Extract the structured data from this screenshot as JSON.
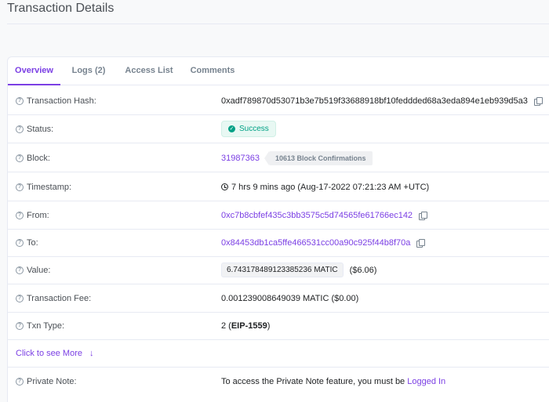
{
  "page": {
    "title": "Transaction Details"
  },
  "tabs": [
    {
      "label": "Overview",
      "active": true
    },
    {
      "label": "Logs (2)"
    },
    {
      "label": "Access List"
    },
    {
      "label": "Comments"
    }
  ],
  "rows": {
    "hash": {
      "label": "Transaction Hash:",
      "value": "0xadf789870d53071b3e7b519f33688918bf10feddded68a3eda894e1eb939d5a3"
    },
    "status": {
      "label": "Status:",
      "value": "Success"
    },
    "block": {
      "label": "Block:",
      "value": "31987363",
      "confirmations": "10613 Block Confirmations"
    },
    "timestamp": {
      "label": "Timestamp:",
      "value": "7 hrs 9 mins ago (Aug-17-2022 07:21:23 AM +UTC)"
    },
    "from": {
      "label": "From:",
      "value": "0xc7b8cbfef435c3bb3575c5d74565fe61766ec142"
    },
    "to": {
      "label": "To:",
      "value": "0x84453db1ca5ffe466531cc00a90c925f44b8f70a"
    },
    "value": {
      "label": "Value:",
      "amount": "6.743178489123385236 MATIC",
      "usd": "($6.06)"
    },
    "fee": {
      "label": "Transaction Fee:",
      "value": "0.001239008649039 MATIC ($0.00)"
    },
    "txn_type": {
      "label": "Txn Type:",
      "prefix": "2 (",
      "type": "EIP-1559",
      "suffix": ")"
    },
    "more": {
      "label": "Click to see More"
    },
    "private_note": {
      "label": "Private Note:",
      "text": "To access the Private Note feature, you must be ",
      "link": "Logged In"
    }
  },
  "colors": {
    "accent": "#7b3fe4",
    "success": "#00a186"
  }
}
